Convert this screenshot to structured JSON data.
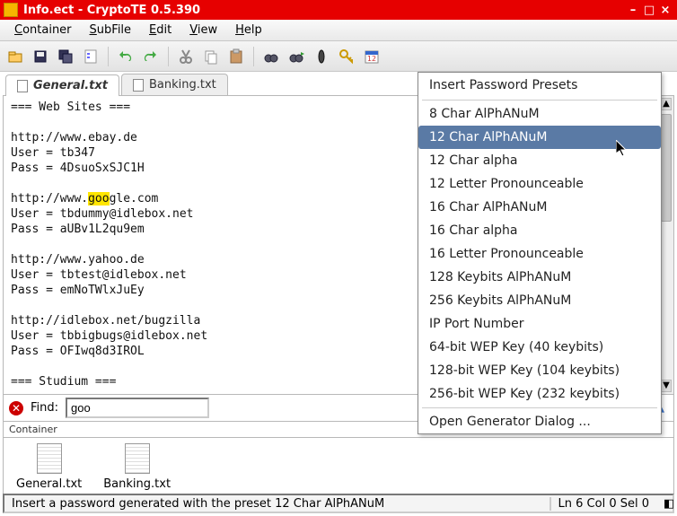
{
  "title": "Info.ect - CryptoTE 0.5.390",
  "menus": [
    "Container",
    "SubFile",
    "Edit",
    "View",
    "Help"
  ],
  "toolbar_icons": [
    "open-container-icon",
    "save-icon",
    "save-all-icon",
    "properties-icon",
    "sep",
    "undo-icon",
    "redo-icon",
    "sep",
    "cut-icon",
    "copy-icon",
    "paste-icon",
    "sep",
    "binoculars-icon",
    "binoculars-next-icon",
    "usb-icon",
    "key-icon",
    "calendar-icon"
  ],
  "tabs": [
    {
      "label": "General.txt",
      "active": true
    },
    {
      "label": "Banking.txt",
      "active": false
    }
  ],
  "editor_lines": [
    "=== Web Sites ===",
    "",
    "http://www.ebay.de",
    "User = tb347",
    "Pass = 4DsuoSxSJC1H",
    "",
    "http://www.google.com",
    "User = tbdummy@idlebox.net",
    "Pass = aUBv1L2qu9em",
    "",
    "http://www.yahoo.de",
    "User = tbtest@idlebox.net",
    "Pass = emNoTWlxJuEy",
    "",
    "http://idlebox.net/bugzilla",
    "User = tbbigbugs@idlebox.net",
    "Pass = OFIwq8d3IROL",
    "",
    "=== Studium ==="
  ],
  "highlight": {
    "line_index": 6,
    "start": 11,
    "len": 3
  },
  "find": {
    "label": "Find:",
    "value": "goo"
  },
  "container": {
    "label": "Container",
    "files": [
      "General.txt",
      "Banking.txt"
    ]
  },
  "dropdown": {
    "title": "Insert Password Presets",
    "items": [
      "8 Char AlPhANuM",
      "12 Char AlPhANuM",
      "12 Char alpha",
      "12 Letter Pronounceable",
      "16 Char AlPhANuM",
      "16 Char alpha",
      "16 Letter Pronounceable",
      "128 Keybits AlPhANuM",
      "256 Keybits AlPhANuM",
      "IP Port Number",
      "64-bit WEP Key (40 keybits)",
      "128-bit WEP Key (104 keybits)",
      "256-bit WEP Key (232 keybits)"
    ],
    "selected_index": 1,
    "footer": "Open Generator Dialog ..."
  },
  "status": {
    "message": "Insert a password generated with the preset 12 Char AlPhANuM",
    "position": "Ln 6 Col 0 Sel 0"
  }
}
